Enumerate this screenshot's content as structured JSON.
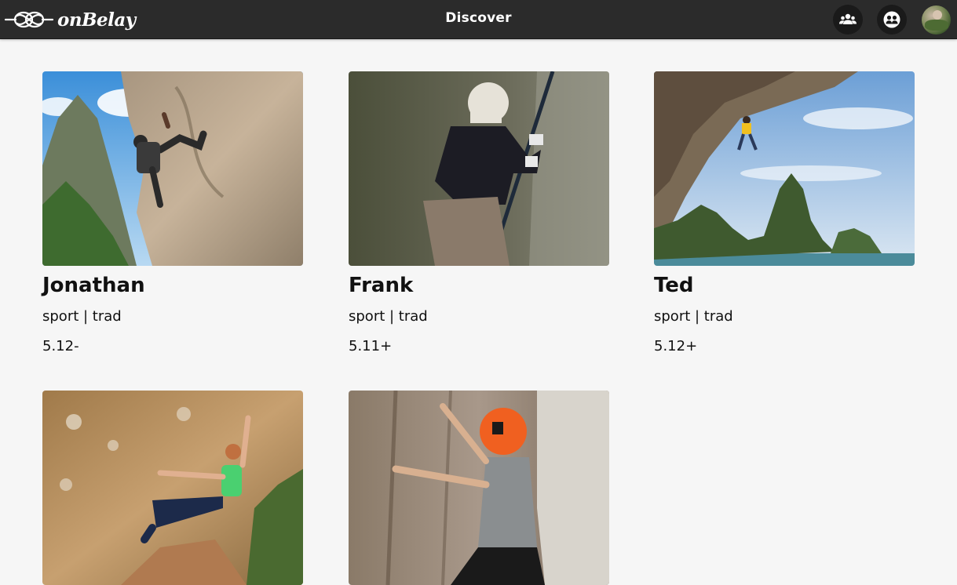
{
  "header": {
    "brand": "onBelay",
    "title": "Discover",
    "icons": {
      "partners": "group-icon",
      "matches": "handshake-icon",
      "profile": "avatar"
    }
  },
  "climbers": [
    {
      "name": "Jonathan",
      "styles": "sport | trad",
      "grade": "5.12-"
    },
    {
      "name": "Frank",
      "styles": "sport | trad",
      "grade": "5.11+"
    },
    {
      "name": "Ted",
      "styles": "sport | trad",
      "grade": "5.12+"
    },
    {
      "name": "",
      "styles": "",
      "grade": ""
    },
    {
      "name": "",
      "styles": "",
      "grade": ""
    }
  ],
  "colors": {
    "topbar": "#2b2b2b",
    "background": "#f6f6f6",
    "text": "#111111"
  }
}
